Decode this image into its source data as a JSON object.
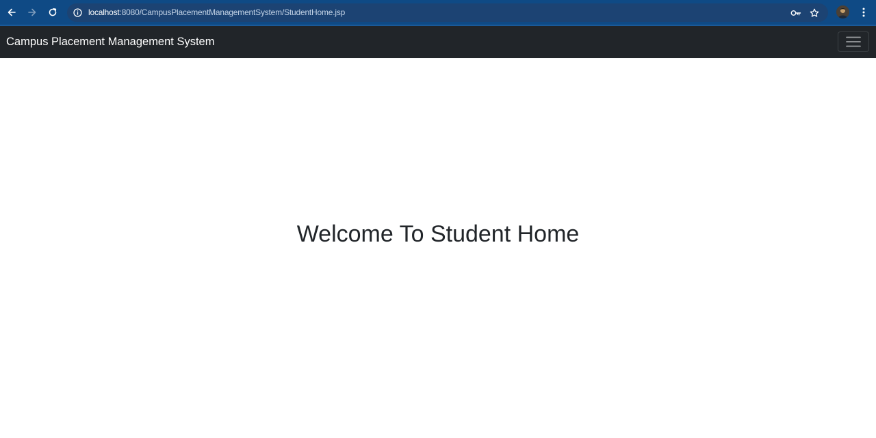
{
  "browser": {
    "url_host": "localhost",
    "url_rest": ":8080/CampusPlacementManagementSystem/StudentHome.jsp",
    "icons": {
      "back": "arrow-left-icon",
      "forward": "arrow-right-icon",
      "reload": "reload-icon",
      "site_info": "info-circle-icon",
      "password": "key-icon",
      "bookmark": "star-icon",
      "menu": "vertical-dots-icon"
    },
    "colors": {
      "toolbar": "#0f4a85",
      "omnibox": "#1c4373"
    }
  },
  "navbar": {
    "brand": "Campus Placement Management System",
    "toggler_icon": "hamburger-icon",
    "background": "#212529"
  },
  "main": {
    "heading": "Welcome To Student Home"
  }
}
